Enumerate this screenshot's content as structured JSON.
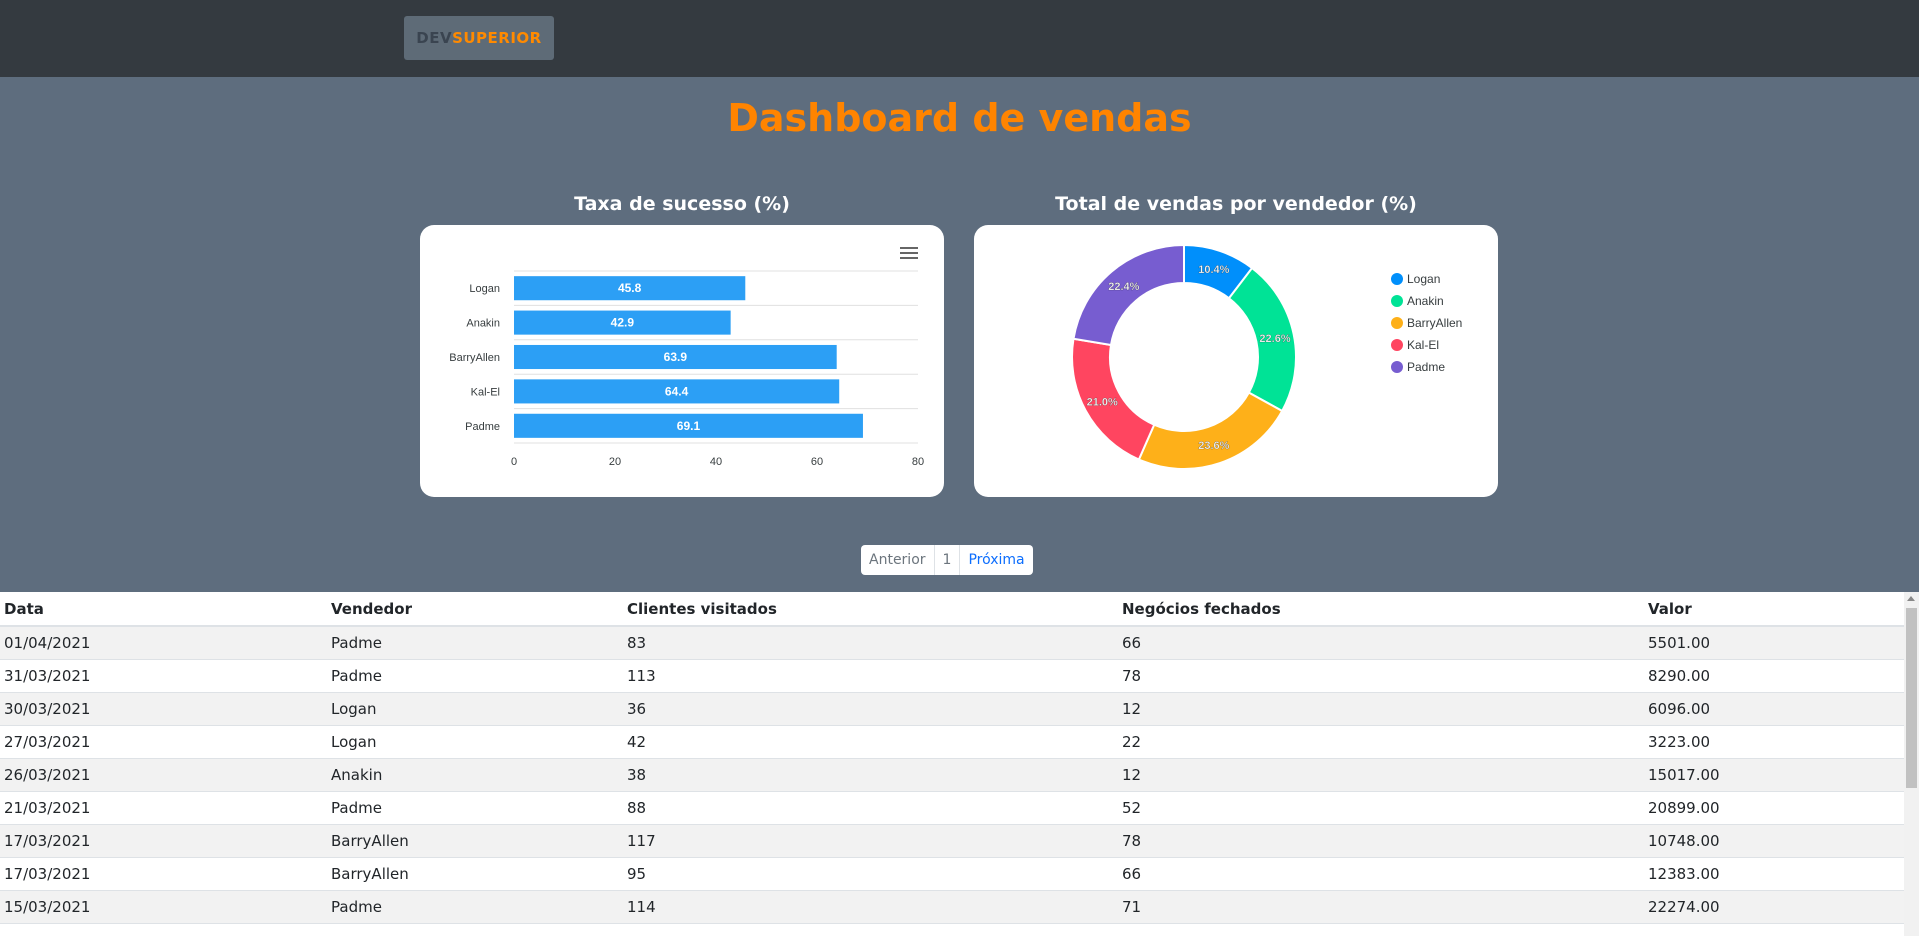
{
  "logo": {
    "part1": "DEV",
    "part2": "SUPERIOR"
  },
  "page_title": "Dashboard de vendas",
  "colors": {
    "accent": "#ff8400",
    "bar": "#2c9ff5",
    "navbar": "#343a40",
    "background": "#5e6d7e"
  },
  "chart_data": [
    {
      "type": "bar",
      "orientation": "horizontal",
      "title": "Taxa de sucesso (%)",
      "categories": [
        "Logan",
        "Anakin",
        "BarryAllen",
        "Kal-El",
        "Padme"
      ],
      "values": [
        45.8,
        42.9,
        63.9,
        64.4,
        69.1
      ],
      "xlim": [
        0,
        80
      ],
      "xticks": [
        0,
        20,
        40,
        60,
        80
      ],
      "color": "#2c9ff5"
    },
    {
      "type": "pie",
      "variant": "donut",
      "title": "Total de vendas por vendedor (%)",
      "labels": [
        "Logan",
        "Anakin",
        "BarryAllen",
        "Kal-El",
        "Padme"
      ],
      "values": [
        10.4,
        22.6,
        23.6,
        21.0,
        22.4
      ],
      "data_labels": [
        "10.4%",
        "22.6%",
        "23.6%",
        "21.0%",
        "22.4%"
      ],
      "colors": [
        "#008ffb",
        "#00e396",
        "#feb019",
        "#ff4560",
        "#775dd0"
      ],
      "legend": "right"
    }
  ],
  "pagination": {
    "prev": "Anterior",
    "current": "1",
    "next": "Próxima"
  },
  "table": {
    "headers": [
      "Data",
      "Vendedor",
      "Clientes visitados",
      "Negócios fechados",
      "Valor"
    ],
    "rows": [
      [
        "01/04/2021",
        "Padme",
        "83",
        "66",
        "5501.00"
      ],
      [
        "31/03/2021",
        "Padme",
        "113",
        "78",
        "8290.00"
      ],
      [
        "30/03/2021",
        "Logan",
        "36",
        "12",
        "6096.00"
      ],
      [
        "27/03/2021",
        "Logan",
        "42",
        "22",
        "3223.00"
      ],
      [
        "26/03/2021",
        "Anakin",
        "38",
        "12",
        "15017.00"
      ],
      [
        "21/03/2021",
        "Padme",
        "88",
        "52",
        "20899.00"
      ],
      [
        "17/03/2021",
        "BarryAllen",
        "117",
        "78",
        "10748.00"
      ],
      [
        "17/03/2021",
        "BarryAllen",
        "95",
        "66",
        "12383.00"
      ],
      [
        "15/03/2021",
        "Padme",
        "114",
        "71",
        "22274.00"
      ]
    ]
  }
}
